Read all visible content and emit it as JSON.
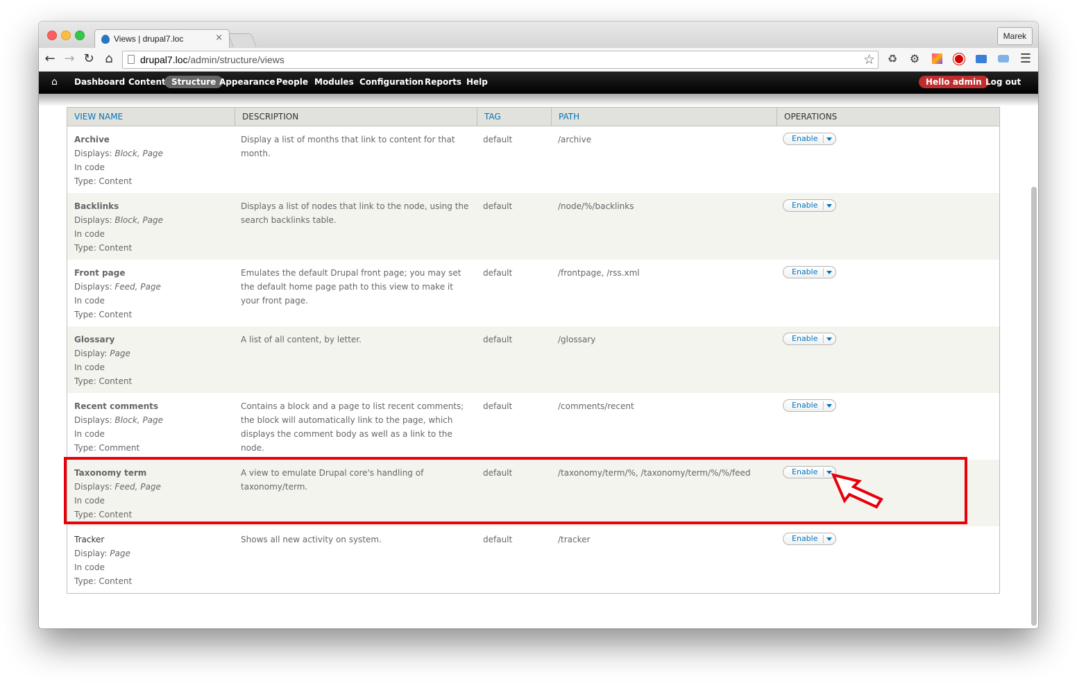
{
  "browser": {
    "tab_title": "Views | drupal7.loc",
    "tab_close": "×",
    "profile": "Marek",
    "url_host": "drupal7.loc",
    "url_path": "/admin/structure/views",
    "icons": [
      "back-arrow-icon",
      "forward-arrow-icon",
      "reload-icon",
      "home-icon",
      "bookmark-star-icon",
      "recycle-extension-icon",
      "gear-extension-icon",
      "color-extension-icon",
      "stop-extension-icon",
      "screen-extension-icon",
      "camera-extension-icon",
      "hamburger-menu-icon"
    ]
  },
  "drupal_toolbar": {
    "items": [
      "Dashboard",
      "Content",
      "Structure",
      "Appearance",
      "People",
      "Modules",
      "Configuration",
      "Reports",
      "Help"
    ],
    "active": "Structure",
    "hello": "Hello admin",
    "logout": "Log out"
  },
  "table": {
    "headers": {
      "name": "VIEW NAME",
      "description": "DESCRIPTION",
      "tag": "TAG",
      "path": "PATH",
      "operations": "OPERATIONS"
    },
    "rows": [
      {
        "name": "Archive",
        "display_label": "Displays:",
        "displays": "Block, Page",
        "storage": "In code",
        "type": "Type: Content",
        "description": "Display a list of months that link to content for that month.",
        "tag": "default",
        "path": "/archive",
        "op": "Enable"
      },
      {
        "name": "Backlinks",
        "display_label": "Displays:",
        "displays": "Block, Page",
        "storage": "In code",
        "type": "Type: Content",
        "description": "Displays a list of nodes that link to the node, using the search backlinks table.",
        "tag": "default",
        "path": "/node/%/backlinks",
        "op": "Enable"
      },
      {
        "name": "Front page",
        "display_label": "Displays:",
        "displays": "Feed, Page",
        "storage": "In code",
        "type": "Type: Content",
        "description": "Emulates the default Drupal front page; you may set the default home page path to this view to make it your front page.",
        "tag": "default",
        "path": "/frontpage, /rss.xml",
        "op": "Enable"
      },
      {
        "name": "Glossary",
        "display_label": "Display:",
        "displays": "Page",
        "storage": "In code",
        "type": "Type: Content",
        "description": "A list of all content, by letter.",
        "tag": "default",
        "path": "/glossary",
        "op": "Enable"
      },
      {
        "name": "Recent comments",
        "display_label": "Displays:",
        "displays": "Block, Page",
        "storage": "In code",
        "type": "Type: Comment",
        "description": "Contains a block and a page to list recent comments; the block will automatically link to the page, which displays the comment body as well as a link to the node.",
        "tag": "default",
        "path": "/comments/recent",
        "op": "Enable"
      },
      {
        "name": "Taxonomy term",
        "display_label": "Displays:",
        "displays": "Feed, Page",
        "storage": "In code",
        "type": "Type: Content",
        "description": "A view to emulate Drupal core's handling of taxonomy/term.",
        "tag": "default",
        "path": "/taxonomy/term/%, /taxonomy/term/%/%/feed",
        "op": "Enable"
      },
      {
        "name": "Tracker",
        "display_label": "Display:",
        "displays": "Page",
        "storage": "In code",
        "type": "Type: Content",
        "description": "Shows all new activity on system.",
        "tag": "default",
        "path": "/tracker",
        "op": "Enable"
      }
    ]
  },
  "annotation": {
    "highlight_color": "#e8000b",
    "highlighted_row": "Taxonomy term"
  }
}
